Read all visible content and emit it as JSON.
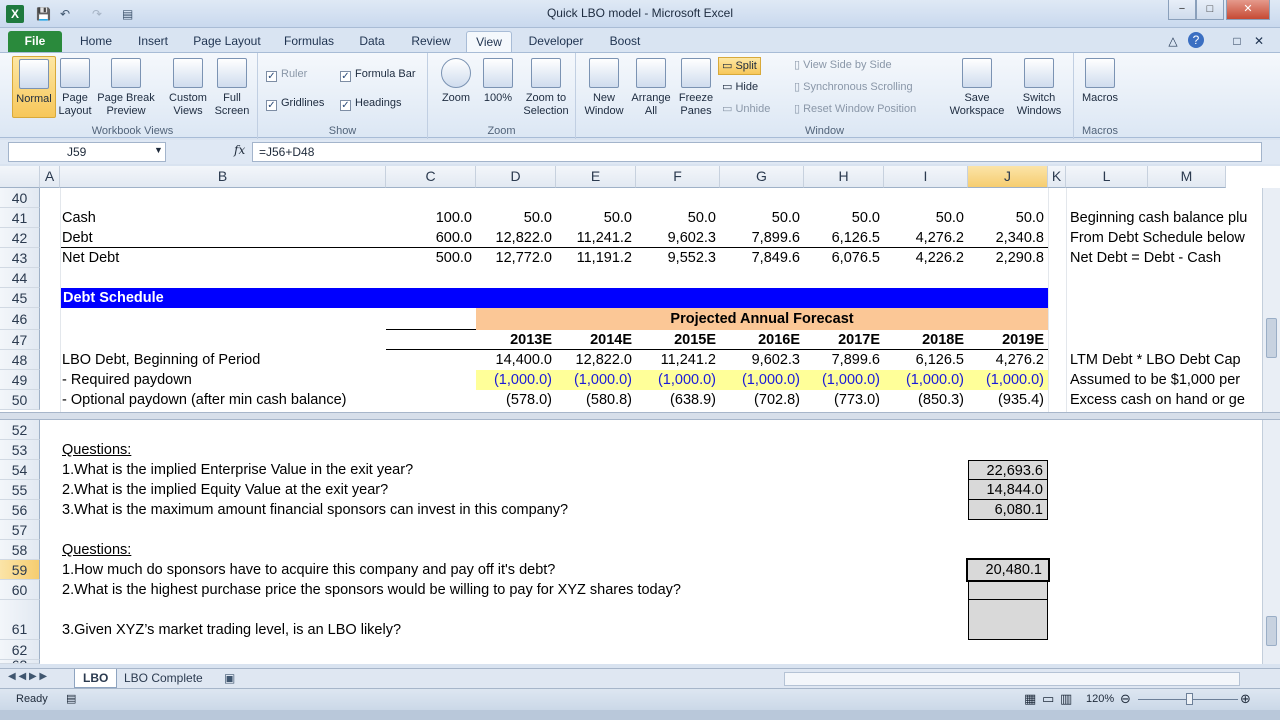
{
  "window": {
    "title": "Quick LBO model - Microsoft Excel",
    "min": "−",
    "max": "□",
    "close": "✕"
  },
  "qat": [
    "💾",
    "↶",
    "↷",
    "▤"
  ],
  "tabs": [
    "File",
    "Home",
    "Insert",
    "Page Layout",
    "Formulas",
    "Data",
    "Review",
    "View",
    "Developer",
    "Boost"
  ],
  "tab_icons": {
    "min": "△",
    "help": "?",
    "restore": "□",
    "close": "✕"
  },
  "ribbon": {
    "workbook_views": {
      "label": "Workbook Views",
      "normal": "Normal",
      "page_layout": "Page Layout",
      "page_break": "Page Break Preview",
      "custom": "Custom Views",
      "full": "Full Screen"
    },
    "show": {
      "label": "Show",
      "ruler": "Ruler",
      "formula_bar": "Formula Bar",
      "gridlines": "Gridlines",
      "headings": "Headings",
      "check": "✓"
    },
    "zoom": {
      "label": "Zoom",
      "zoom": "Zoom",
      "hundred": "100%",
      "selection": "Zoom to Selection"
    },
    "window": {
      "label": "Window",
      "new": "New Window",
      "arrange": "Arrange All",
      "freeze": "Freeze Panes",
      "split": "Split",
      "hide": "Hide",
      "unhide": "Unhide",
      "side": "View Side by Side",
      "sync": "Synchronous Scrolling",
      "reset": "Reset Window Position",
      "save": "Save Workspace",
      "switch": "Switch Windows"
    },
    "macros": {
      "label": "Macros",
      "macros": "Macros"
    }
  },
  "formula_bar": {
    "name": "J59",
    "fx": "fx",
    "formula": "=J56+D48"
  },
  "columns": [
    "A",
    "B",
    "C",
    "D",
    "E",
    "F",
    "G",
    "H",
    "I",
    "J",
    "K",
    "L",
    "M"
  ],
  "rows_top": [
    "40",
    "41",
    "42",
    "43",
    "44",
    "45",
    "46",
    "47",
    "48",
    "49",
    "50"
  ],
  "rows_bottom": [
    "52",
    "53",
    "54",
    "55",
    "56",
    "57",
    "58",
    "59",
    "60",
    "61",
    "62",
    "63"
  ],
  "cells": {
    "r41": {
      "label": "Cash",
      "c": "100.0",
      "vals": [
        "50.0",
        "50.0",
        "50.0",
        "50.0",
        "50.0",
        "50.0",
        "50.0"
      ],
      "note": "Beginning cash balance plu"
    },
    "r42": {
      "label": "Debt",
      "c": "600.0",
      "vals": [
        "12,822.0",
        "11,241.2",
        "9,602.3",
        "7,899.6",
        "6,126.5",
        "4,276.2",
        "2,340.8"
      ],
      "note": "From Debt Schedule below"
    },
    "r43": {
      "label": "Net Debt",
      "c": "500.0",
      "vals": [
        "12,772.0",
        "11,191.2",
        "9,552.3",
        "7,849.6",
        "6,076.5",
        "4,226.2",
        "2,290.8"
      ],
      "note": "Net Debt = Debt - Cash"
    },
    "r45": {
      "label": "Debt Schedule"
    },
    "r46": {
      "label": "Projected Annual Forecast"
    },
    "r47": {
      "years": [
        "2013E",
        "2014E",
        "2015E",
        "2016E",
        "2017E",
        "2018E",
        "2019E"
      ]
    },
    "r48": {
      "label": "LBO Debt, Beginning of Period",
      "vals": [
        "14,400.0",
        "12,822.0",
        "11,241.2",
        "9,602.3",
        "7,899.6",
        "6,126.5",
        "4,276.2"
      ],
      "note": "LTM Debt * LBO Debt Cap"
    },
    "r49": {
      "label": " - Required paydown",
      "vals": [
        "(1,000.0)",
        "(1,000.0)",
        "(1,000.0)",
        "(1,000.0)",
        "(1,000.0)",
        "(1,000.0)",
        "(1,000.0)"
      ],
      "note": "Assumed to be $1,000 per"
    },
    "r50": {
      "label": " - Optional paydown (after min cash balance)",
      "vals": [
        "(578.0)",
        "(580.8)",
        "(638.9)",
        "(702.8)",
        "(773.0)",
        "(850.3)",
        "(935.4)"
      ],
      "note": "Excess cash on hand or ge"
    },
    "r53": {
      "label": "Questions:"
    },
    "r54": {
      "label": "1.What is the implied Enterprise Value in the exit year?",
      "j": "22,693.6"
    },
    "r55": {
      "label": "2.What is the implied Equity Value at the exit year?",
      "j": "14,844.0"
    },
    "r56": {
      "label": "3.What is the maximum amount financial sponsors can invest in this company?",
      "j": "6,080.1"
    },
    "r58": {
      "label": "Questions:"
    },
    "r59": {
      "label": "1.How much do sponsors have to acquire this company and pay off it's debt?",
      "j": "20,480.1"
    },
    "r60": {
      "label": "2.What is the highest purchase price the sponsors would be willing to pay for XYZ shares today?"
    },
    "r61": {
      "label": "3.Given XYZ’s market trading level, is an LBO likely?"
    }
  },
  "sheets": [
    "LBO",
    "LBO Complete"
  ],
  "status": {
    "ready": "Ready",
    "zoom": "120%"
  },
  "colors": {
    "debt_schedule_bar": "#0000ff",
    "forecast_header": "#fbc796",
    "required_paydown_fill": "#ffff99",
    "answer_fill": "#d9d9d9",
    "selected_header": "#f6cd70"
  }
}
